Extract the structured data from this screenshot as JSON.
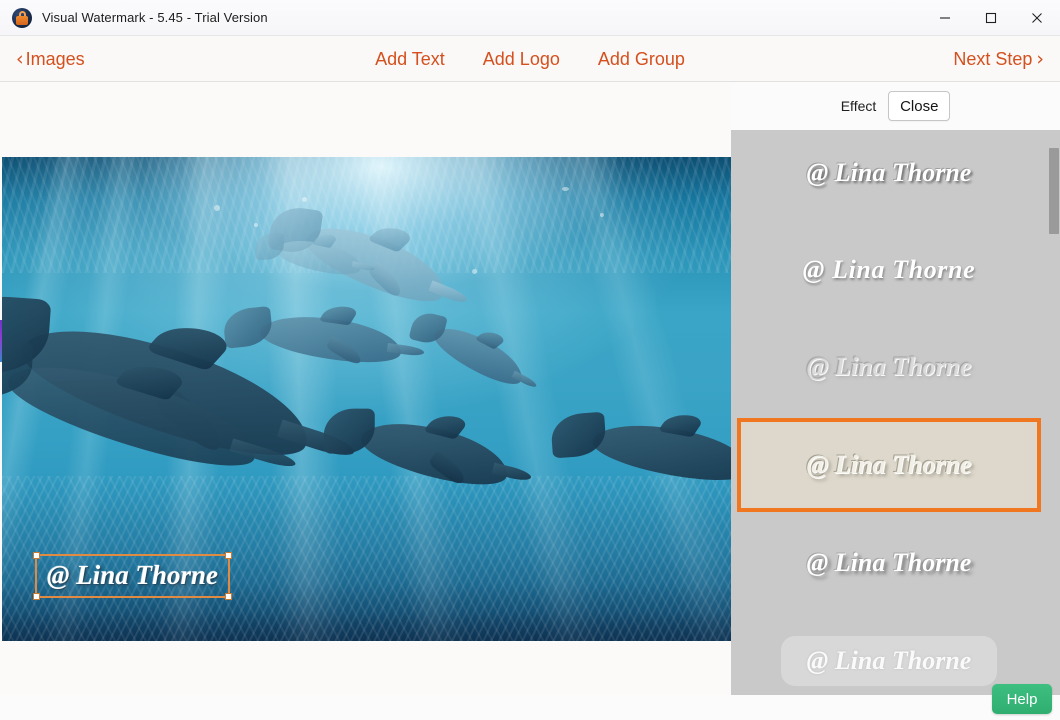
{
  "window": {
    "title": "Visual Watermark - 5.45 - Trial Version",
    "app_icon": "lock-icon",
    "minimize_label": "─",
    "maximize_label": "□",
    "close_label": "✕"
  },
  "toolbar": {
    "back_chevron": "‹",
    "back_label": "Images",
    "add_text_label": "Add Text",
    "add_logo_label": "Add Logo",
    "add_group_label": "Add Group",
    "next_step_label": "Next Step",
    "next_chevron": "›",
    "accent_color": "#d4501e"
  },
  "canvas": {
    "watermark_text": "@ Lina Thorne",
    "selection_border_color": "#e08a42",
    "image_description": "underwater-dolphins-photo"
  },
  "panel": {
    "effect_label": "Effect",
    "close_label": "Close",
    "background_color": "#c9c9c9",
    "selected_index": 3,
    "selected_border_color": "#f0761f",
    "selected_background_color": "#ddd8cb",
    "effects": [
      {
        "preview_text": "@ Lina Thorne"
      },
      {
        "preview_text": "@ Lina Thorne"
      },
      {
        "preview_text": "@ Lina Thorne"
      },
      {
        "preview_text": "@ Lina Thorne"
      },
      {
        "preview_text": "@ Lina Thorne"
      },
      {
        "preview_text": "@ Lina Thorne"
      }
    ]
  },
  "footer": {
    "help_label": "Help",
    "help_color": "#35b578"
  }
}
